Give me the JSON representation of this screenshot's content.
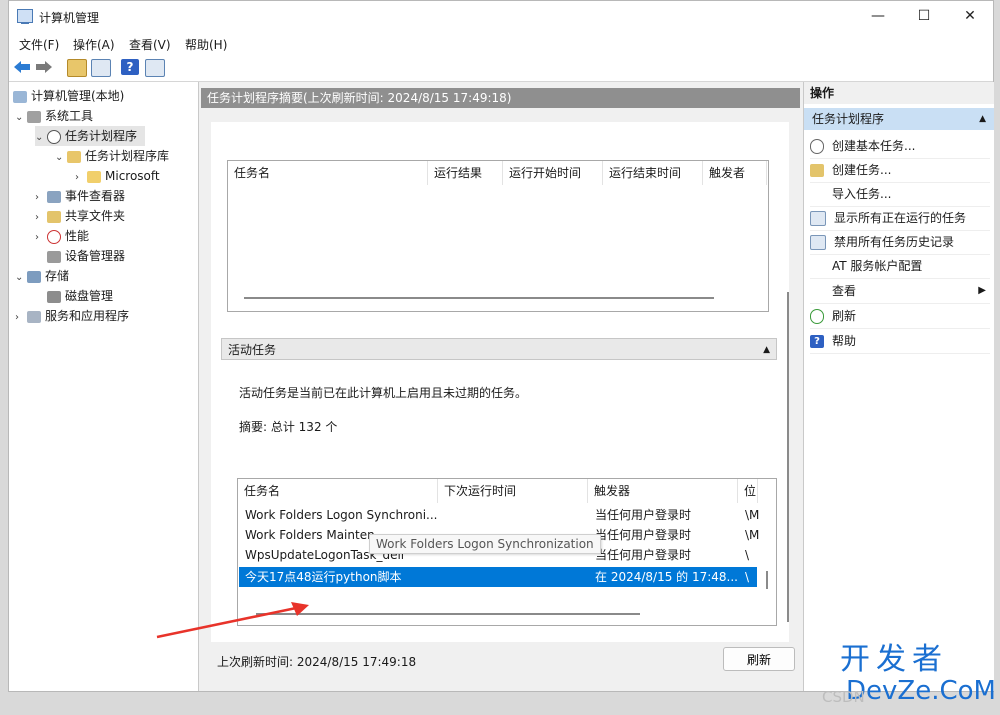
{
  "window": {
    "title": "计算机管理",
    "minimize": "—",
    "maximize": "☐",
    "close": "✕"
  },
  "menu": [
    "文件(F)",
    "操作(A)",
    "查看(V)",
    "帮助(H)"
  ],
  "tree": [
    {
      "label": "计算机管理(本地)"
    },
    {
      "label": "系统工具"
    },
    {
      "label": "任务计划程序"
    },
    {
      "label": "任务计划程序库"
    },
    {
      "label": "Microsoft"
    },
    {
      "label": "事件查看器"
    },
    {
      "label": "共享文件夹"
    },
    {
      "label": "性能"
    },
    {
      "label": "设备管理器"
    },
    {
      "label": "存储"
    },
    {
      "label": "磁盘管理"
    },
    {
      "label": "服务和应用程序"
    }
  ],
  "center": {
    "header": "任务计划程序摘要(上次刷新时间: 2024/8/15 17:49:18)",
    "top_grid_columns": [
      "任务名",
      "运行结果",
      "运行开始时间",
      "运行结束时间",
      "触发者"
    ],
    "section_title": "活动任务",
    "description": "活动任务是当前已在此计算机上启用且未过期的任务。",
    "summary": "摘要: 总计 132 个",
    "active_columns": [
      "任务名",
      "下次运行时间",
      "触发器",
      "位"
    ],
    "active_rows": [
      {
        "name": "Work Folders Logon Synchroni...",
        "next": "",
        "trigger": "当任何用户登录时",
        "loc": "\\M"
      },
      {
        "name": "Work Folders Mainten",
        "next": "",
        "trigger": "当任何用户登录时",
        "loc": "\\M"
      },
      {
        "name": "WpsUpdateLogonTask_dell",
        "next": "",
        "trigger": "当任何用户登录时",
        "loc": "\\"
      },
      {
        "name": "今天17点48运行python脚本",
        "next": "",
        "trigger": "在 2024/8/15 的 17:48...",
        "loc": "\\"
      }
    ],
    "tooltip": "Work Folders Logon Synchronization",
    "last_refresh": "上次刷新时间: 2024/8/15 17:49:18",
    "refresh_button": "刷新"
  },
  "actions": {
    "title": "操作",
    "subtitle": "任务计划程序",
    "items": [
      "创建基本任务...",
      "创建任务...",
      "导入任务...",
      "显示所有正在运行的任务",
      "禁用所有任务历史记录",
      "AT 服务帐户配置",
      "查看",
      "刷新",
      "帮助"
    ]
  },
  "watermark": {
    "line1": "开发者",
    "line2": "DevZe.CoM",
    "csdn": "CSDN"
  },
  "colors": {
    "selection": "#0078d7",
    "header_bar": "#8f8f8f",
    "arrow": "#e8332a"
  }
}
